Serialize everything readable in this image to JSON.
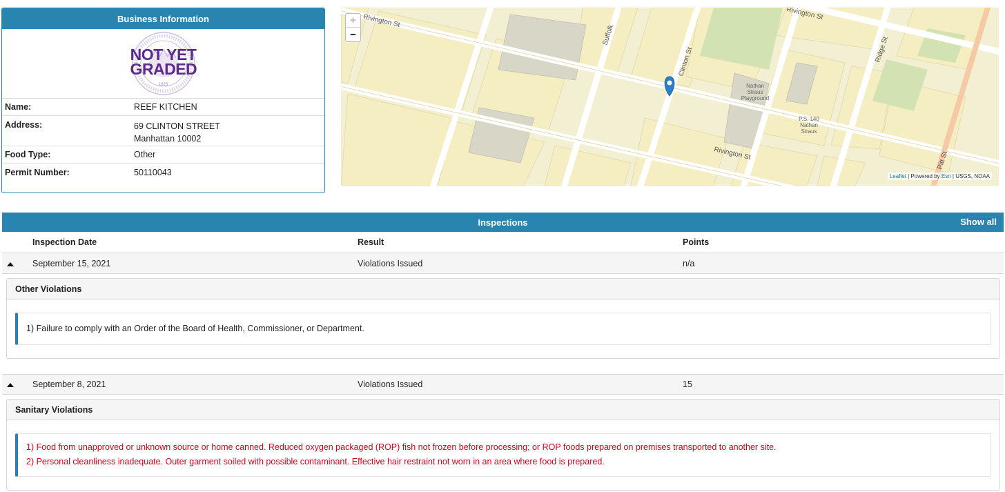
{
  "business": {
    "header": "Business Information",
    "grade_line1": "NOT YET",
    "grade_line2": "GRADED",
    "seal_year": "1625",
    "fields": [
      {
        "label": "Name:",
        "value": "REEF KITCHEN"
      },
      {
        "label": "Address:",
        "line1": "69 CLINTON STREET",
        "line2": "Manhattan 10002"
      },
      {
        "label": "Food Type:",
        "value": "Other"
      },
      {
        "label": "Permit Number:",
        "value": "50110043"
      }
    ]
  },
  "map": {
    "zoom_in": "+",
    "zoom_out": "−",
    "streets": [
      "Rivington St",
      "Rivington St",
      "Clinton St",
      "Suffolk",
      "Ridge St",
      "Pitt St",
      "Rivington St"
    ],
    "places": [
      "Nathan",
      "Straus",
      "Playground",
      "P.S. 140",
      "Nathan",
      "Straus"
    ],
    "attribution_leaflet": "Leaflet",
    "attribution_mid": "| Powered by",
    "attribution_esri": "Esri",
    "attribution_end": "| USGS, NOAA"
  },
  "inspections": {
    "header": "Inspections",
    "show_all": "Show all",
    "columns": {
      "date": "Inspection Date",
      "result": "Result",
      "points": "Points"
    },
    "rows": [
      {
        "date": "September 15, 2021",
        "result": "Violations Issued",
        "points": "n/a",
        "violation_category": "Other Violations",
        "violations": [
          "1) Failure to comply with an Order of the Board of Health, Commissioner, or Department."
        ]
      },
      {
        "date": "September 8, 2021",
        "result": "Violations Issued",
        "points": "15",
        "violation_category": "Sanitary Violations",
        "violations": [
          "1) Food from unapproved or unknown source or home canned. Reduced oxygen packaged (ROP) fish not frozen before processing; or ROP foods prepared on premises transported to another site.",
          "2) Personal cleanliness inadequate. Outer garment soiled with possible contaminant. Effective hair restraint not worn in an area where food is prepared."
        ]
      }
    ]
  },
  "colors": {
    "header_blue": "#2a84b0",
    "grade_purple": "#5c2a8c",
    "violation_red": "#d0021b",
    "map_bg": "#f3efd2",
    "building": "#f5eec2"
  }
}
